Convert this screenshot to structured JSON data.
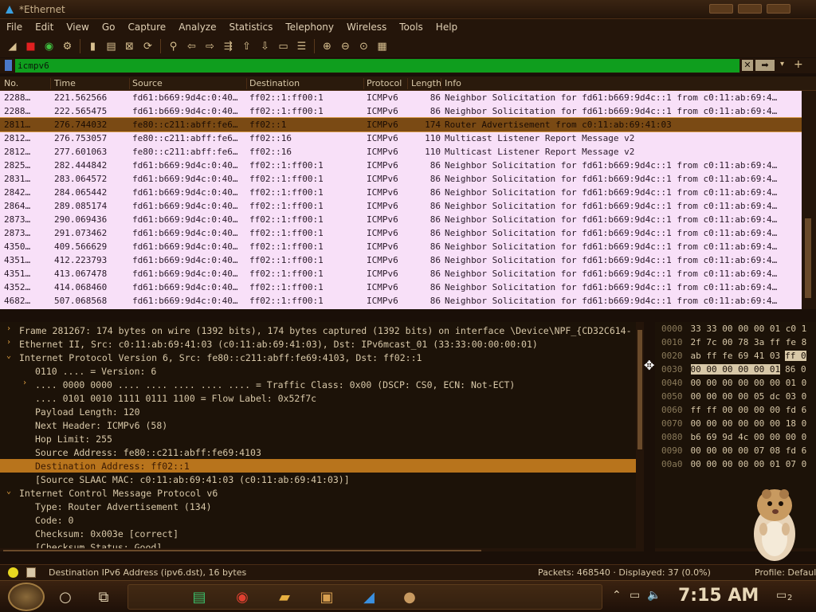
{
  "window": {
    "title": "*Ethernet"
  },
  "menu": [
    "File",
    "Edit",
    "View",
    "Go",
    "Capture",
    "Analyze",
    "Statistics",
    "Telephony",
    "Wireless",
    "Tools",
    "Help"
  ],
  "toolbar_icons": [
    "shark-fin-start-icon",
    "stop-icon",
    "restart-icon",
    "options-icon",
    "open-icon",
    "save-icon",
    "close-file-icon",
    "reload-icon",
    "find-icon",
    "back-icon",
    "forward-icon",
    "goto-icon",
    "first-icon",
    "last-icon",
    "autoscroll-icon",
    "colorize-icon",
    "zoom-in-icon",
    "zoom-out-icon",
    "zoom-reset-icon",
    "resize-columns-icon"
  ],
  "filter": {
    "value": "icmpv6"
  },
  "columns": [
    "No.",
    "Time",
    "Source",
    "Destination",
    "Protocol",
    "Length",
    "Info"
  ],
  "packets": [
    {
      "no": "2288…",
      "time": "221.562566",
      "src": "fd61:b669:9d4c:0:40…",
      "dst": "ff02::1:ff00:1",
      "proto": "ICMPv6",
      "len": "86",
      "info": "Neighbor Solicitation for fd61:b669:9d4c::1 from c0:11:ab:69:4…"
    },
    {
      "no": "2288…",
      "time": "222.565475",
      "src": "fd61:b669:9d4c:0:40…",
      "dst": "ff02::1:ff00:1",
      "proto": "ICMPv6",
      "len": "86",
      "info": "Neighbor Solicitation for fd61:b669:9d4c::1 from c0:11:ab:69:4…"
    },
    {
      "no": "2811…",
      "time": "276.744032",
      "src": "fe80::c211:abff:fe6…",
      "dst": "ff02::1",
      "proto": "ICMPv6",
      "len": "174",
      "info": "Router Advertisement from c0:11:ab:69:41:03",
      "selected": true
    },
    {
      "no": "2812…",
      "time": "276.753057",
      "src": "fe80::c211:abff:fe6…",
      "dst": "ff02::16",
      "proto": "ICMPv6",
      "len": "110",
      "info": "Multicast Listener Report Message v2"
    },
    {
      "no": "2812…",
      "time": "277.601063",
      "src": "fe80::c211:abff:fe6…",
      "dst": "ff02::16",
      "proto": "ICMPv6",
      "len": "110",
      "info": "Multicast Listener Report Message v2"
    },
    {
      "no": "2825…",
      "time": "282.444842",
      "src": "fd61:b669:9d4c:0:40…",
      "dst": "ff02::1:ff00:1",
      "proto": "ICMPv6",
      "len": "86",
      "info": "Neighbor Solicitation for fd61:b669:9d4c::1 from c0:11:ab:69:4…"
    },
    {
      "no": "2831…",
      "time": "283.064572",
      "src": "fd61:b669:9d4c:0:40…",
      "dst": "ff02::1:ff00:1",
      "proto": "ICMPv6",
      "len": "86",
      "info": "Neighbor Solicitation for fd61:b669:9d4c::1 from c0:11:ab:69:4…"
    },
    {
      "no": "2842…",
      "time": "284.065442",
      "src": "fd61:b669:9d4c:0:40…",
      "dst": "ff02::1:ff00:1",
      "proto": "ICMPv6",
      "len": "86",
      "info": "Neighbor Solicitation for fd61:b669:9d4c::1 from c0:11:ab:69:4…"
    },
    {
      "no": "2864…",
      "time": "289.085174",
      "src": "fd61:b669:9d4c:0:40…",
      "dst": "ff02::1:ff00:1",
      "proto": "ICMPv6",
      "len": "86",
      "info": "Neighbor Solicitation for fd61:b669:9d4c::1 from c0:11:ab:69:4…"
    },
    {
      "no": "2873…",
      "time": "290.069436",
      "src": "fd61:b669:9d4c:0:40…",
      "dst": "ff02::1:ff00:1",
      "proto": "ICMPv6",
      "len": "86",
      "info": "Neighbor Solicitation for fd61:b669:9d4c::1 from c0:11:ab:69:4…"
    },
    {
      "no": "2873…",
      "time": "291.073462",
      "src": "fd61:b669:9d4c:0:40…",
      "dst": "ff02::1:ff00:1",
      "proto": "ICMPv6",
      "len": "86",
      "info": "Neighbor Solicitation for fd61:b669:9d4c::1 from c0:11:ab:69:4…"
    },
    {
      "no": "4350…",
      "time": "409.566629",
      "src": "fd61:b669:9d4c:0:40…",
      "dst": "ff02::1:ff00:1",
      "proto": "ICMPv6",
      "len": "86",
      "info": "Neighbor Solicitation for fd61:b669:9d4c::1 from c0:11:ab:69:4…"
    },
    {
      "no": "4351…",
      "time": "412.223793",
      "src": "fd61:b669:9d4c:0:40…",
      "dst": "ff02::1:ff00:1",
      "proto": "ICMPv6",
      "len": "86",
      "info": "Neighbor Solicitation for fd61:b669:9d4c::1 from c0:11:ab:69:4…"
    },
    {
      "no": "4351…",
      "time": "413.067478",
      "src": "fd61:b669:9d4c:0:40…",
      "dst": "ff02::1:ff00:1",
      "proto": "ICMPv6",
      "len": "86",
      "info": "Neighbor Solicitation for fd61:b669:9d4c::1 from c0:11:ab:69:4…"
    },
    {
      "no": "4352…",
      "time": "414.068460",
      "src": "fd61:b669:9d4c:0:40…",
      "dst": "ff02::1:ff00:1",
      "proto": "ICMPv6",
      "len": "86",
      "info": "Neighbor Solicitation for fd61:b669:9d4c::1 from c0:11:ab:69:4…"
    },
    {
      "no": "4682…",
      "time": "507.068568",
      "src": "fd61:b669:9d4c:0:40…",
      "dst": "ff02::1:ff00:1",
      "proto": "ICMPv6",
      "len": "86",
      "info": "Neighbor Solicitation for fd61:b669:9d4c::1 from c0:11:ab:69:4…"
    }
  ],
  "details": [
    {
      "text": "Frame 281267: 174 bytes on wire (1392 bits), 174 bytes captured (1392 bits) on interface \\Device\\NPF_{CD32C614-",
      "indent": 0,
      "arrow": "collapsed"
    },
    {
      "text": "Ethernet II, Src: c0:11:ab:69:41:03 (c0:11:ab:69:41:03), Dst: IPv6mcast_01 (33:33:00:00:00:01)",
      "indent": 0,
      "arrow": "collapsed"
    },
    {
      "text": "Internet Protocol Version 6, Src: fe80::c211:abff:fe69:4103, Dst: ff02::1",
      "indent": 0,
      "arrow": "expanded"
    },
    {
      "text": "0110 .... = Version: 6",
      "indent": 1,
      "arrow": "none"
    },
    {
      "text": ".... 0000 0000 .... .... .... .... .... = Traffic Class: 0x00 (DSCP: CS0, ECN: Not-ECT)",
      "indent": 1,
      "arrow": "collapsed"
    },
    {
      "text": ".... 0101 0010 1111 0111 1100 = Flow Label: 0x52f7c",
      "indent": 1,
      "arrow": "none"
    },
    {
      "text": "Payload Length: 120",
      "indent": 1,
      "arrow": "none"
    },
    {
      "text": "Next Header: ICMPv6 (58)",
      "indent": 1,
      "arrow": "none"
    },
    {
      "text": "Hop Limit: 255",
      "indent": 1,
      "arrow": "none"
    },
    {
      "text": "Source Address: fe80::c211:abff:fe69:4103",
      "indent": 1,
      "arrow": "none"
    },
    {
      "text": "Destination Address: ff02::1",
      "indent": 1,
      "arrow": "none",
      "selected": true
    },
    {
      "text": "[Source SLAAC MAC: c0:11:ab:69:41:03 (c0:11:ab:69:41:03)]",
      "indent": 1,
      "arrow": "none"
    },
    {
      "text": "Internet Control Message Protocol v6",
      "indent": 0,
      "arrow": "expanded"
    },
    {
      "text": "Type: Router Advertisement (134)",
      "indent": 1,
      "arrow": "none"
    },
    {
      "text": "Code: 0",
      "indent": 1,
      "arrow": "none"
    },
    {
      "text": "Checksum: 0x003e [correct]",
      "indent": 1,
      "arrow": "none"
    },
    {
      "text": "[Checksum Status: Good]",
      "indent": 1,
      "arrow": "none"
    }
  ],
  "bytes": [
    {
      "off": "0000",
      "hex": "33 33 00 00 00 01 c0 1"
    },
    {
      "off": "0010",
      "hex": "2f 7c 00 78 3a ff fe 8"
    },
    {
      "off": "0020",
      "hex": "ab ff fe 69 41 03",
      "hl": "ff 0"
    },
    {
      "off": "0030",
      "hexhl": "00 00 00 00 00 01",
      "hex": "86 0"
    },
    {
      "off": "0040",
      "hex": "00 00 00 00 00 00 01 0"
    },
    {
      "off": "0050",
      "hex": "00 00 00 00 05 dc 03 0"
    },
    {
      "off": "0060",
      "hex": "ff ff 00 00 00 00 fd 6"
    },
    {
      "off": "0070",
      "hex": "00 00 00 00 00 00 18 0"
    },
    {
      "off": "0080",
      "hex": "b6 69 9d 4c 00 00 00 0"
    },
    {
      "off": "0090",
      "hex": "00 00 00 00 07 08 fd 6"
    },
    {
      "off": "00a0",
      "hex": "00 00 00 00 00 01 07 0"
    }
  ],
  "status": {
    "field_info": "Destination IPv6 Address (ipv6.dst), 16 bytes",
    "packets": "Packets: 468540 · Displayed: 37 (0.0%)",
    "profile": "Profile: Default"
  },
  "taskbar": {
    "clock": "7:15 AM",
    "notifications": "2"
  },
  "colors": {
    "accent": "#b8741c",
    "filter_valid": "#0f9e1e",
    "packet_bg": "#f8e0f8"
  }
}
